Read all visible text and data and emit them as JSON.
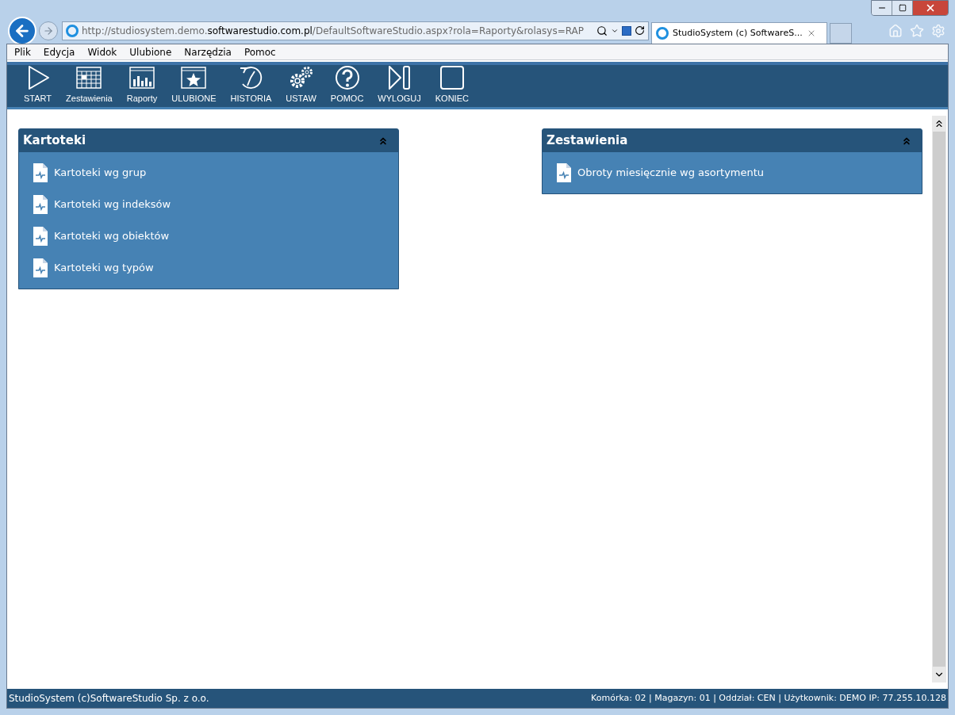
{
  "address_bar": {
    "url_start": "http://studiosystem.demo.",
    "url_domain": "softwarestudio.com.pl",
    "url_end": "/DefaultSoftwareStudio.aspx?rola=Raporty&rolasys=RAP"
  },
  "tab": {
    "title": "StudioSystem (c) SoftwareS...",
    "selected": true
  },
  "menu": [
    "Plik",
    "Edycja",
    "Widok",
    "Ulubione",
    "Narzędzia",
    "Pomoc"
  ],
  "toolbar": [
    {
      "label": "START"
    },
    {
      "label": "Zestawienia"
    },
    {
      "label": "Raporty"
    },
    {
      "label": "ULUBIONE"
    },
    {
      "label": "HISTORIA"
    },
    {
      "label": "USTAW"
    },
    {
      "label": "POMOC"
    },
    {
      "label": "WYLOGUJ"
    },
    {
      "label": "KONIEC"
    }
  ],
  "panels": [
    {
      "title": "Kartoteki",
      "expanded": true,
      "items": [
        "Kartoteki wg grup",
        "Kartoteki wg indeksów",
        "Kartoteki wg obiektów",
        "Kartoteki wg typów"
      ]
    },
    {
      "title": "Zestawienia",
      "expanded": true,
      "items": [
        "Obroty miesięcznie wg asortymentu"
      ]
    }
  ],
  "status_bar": {
    "left": "StudioSystem (c)SoftwareStudio Sp. z o.o.",
    "right": "Komórka: 02 | Magazyn: 01 | Oddział: CEN | Użytkownik: DEMO IP: 77.255.10.128"
  }
}
